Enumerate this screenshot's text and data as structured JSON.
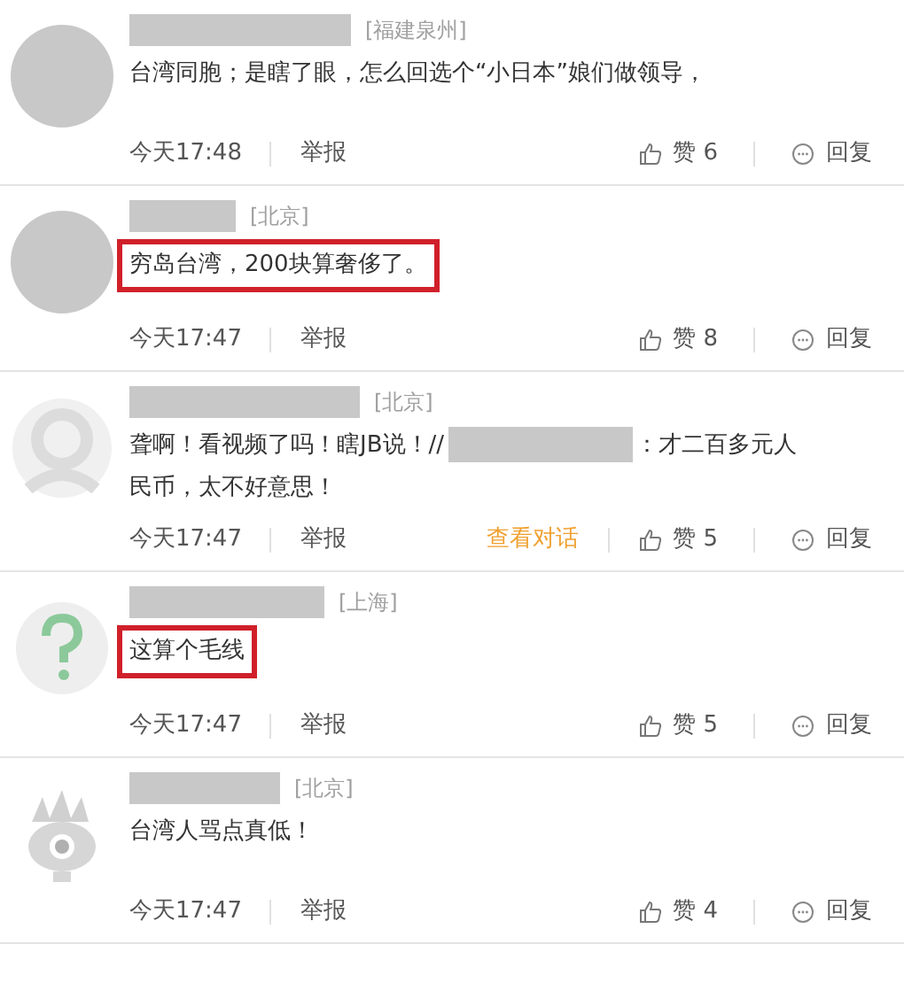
{
  "comments": [
    {
      "avatar": {
        "kind": "blank"
      },
      "location": "[福建泉州]",
      "segments": [
        {
          "kind": "text",
          "text": "台湾同胞；是瞎了眼，怎么回选个“小日本”娘们做领导，"
        }
      ],
      "highlighted": false,
      "time": "今天17:48",
      "report": "举报",
      "likes": "赞 6",
      "reply": "回复"
    },
    {
      "avatar": {
        "kind": "blank"
      },
      "location": "[北京]",
      "segments": [
        {
          "kind": "text",
          "text": "穷岛台湾，200块算奢侈了。"
        }
      ],
      "highlighted": true,
      "time": "今天17:47",
      "report": "举报",
      "likes": "赞 8",
      "reply": "回复"
    },
    {
      "avatar": {
        "kind": "person"
      },
      "location": "[北京]",
      "segments": [
        {
          "kind": "text",
          "text": "聋啊！看视频了吗！瞎JB说！//"
        },
        {
          "kind": "redaction"
        },
        {
          "kind": "text",
          "text": "：才二百多元人"
        },
        {
          "kind": "break"
        },
        {
          "kind": "text",
          "text": "民币，太不好意思！"
        }
      ],
      "highlighted": false,
      "time": "今天17:47",
      "report": "举报",
      "conversation": "查看对话",
      "likes": "赞 5",
      "reply": "回复"
    },
    {
      "avatar": {
        "kind": "unknown"
      },
      "location": "[上海]",
      "segments": [
        {
          "kind": "text",
          "text": "这算个毛线"
        }
      ],
      "highlighted": true,
      "time": "今天17:47",
      "report": "举报",
      "likes": "赞 5",
      "reply": "回复"
    },
    {
      "avatar": {
        "kind": "eye"
      },
      "location": "[北京]",
      "segments": [
        {
          "kind": "text",
          "text": "台湾人骂点真低！"
        }
      ],
      "highlighted": false,
      "time": "今天17:47",
      "report": "举报",
      "likes": "赞 4",
      "reply": "回复"
    }
  ]
}
